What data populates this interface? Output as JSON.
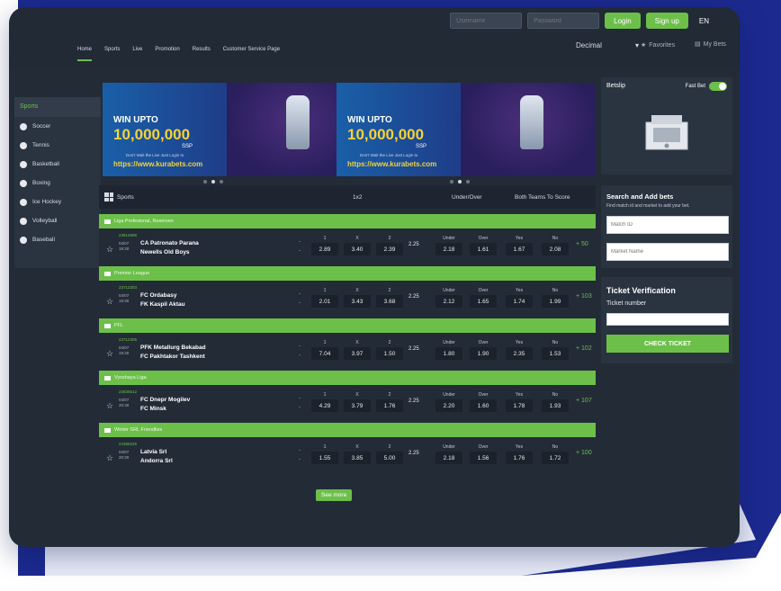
{
  "header": {
    "username_placeholder": "Username",
    "password_placeholder": "Password",
    "login_label": "Login",
    "signup_label": "Sign up",
    "language": "EN",
    "odds_format": "Decimal",
    "favorites_label": "Favorites",
    "mybets_label": "My Bets"
  },
  "nav": [
    "Home",
    "Sports",
    "Live",
    "Promotion",
    "Results",
    "Customer Service Page"
  ],
  "sidebar": {
    "title": "Sports",
    "items": [
      "Soccer",
      "Tennis",
      "Basketball",
      "Boxing",
      "Ice Hockey",
      "Volleyball",
      "Baseball"
    ]
  },
  "banner": {
    "win": "WIN UPTO",
    "amount": "10,000,000",
    "currency": "SSP",
    "small": "Don't Wait the Live Just Login to",
    "url": "https://www.kurabets.com"
  },
  "table": {
    "col_sports": "Sports",
    "col_1x2": "1x2",
    "col_uo": "Under/Over",
    "col_bts": "Both Teams To Score",
    "labels": [
      "1",
      "X",
      "2",
      "Under",
      "Over",
      "Yes",
      "No"
    ]
  },
  "leagues": [
    {
      "name": "Liga Profesional, Reserves",
      "match": {
        "id": "23814998",
        "date": "04/07",
        "time": "19:30",
        "home": "CA Patronato Parana",
        "away": "Newells Old Boys",
        "o1": "2.89",
        "ox": "3.40",
        "o2": "2.39",
        "hcp": "2.25",
        "under": "2.18",
        "over": "1.61",
        "yes": "1.67",
        "no": "2.08",
        "more": "+ 50"
      }
    },
    {
      "name": "Premier League",
      "match": {
        "id": "23712303",
        "date": "04/07",
        "time": "19:30",
        "home": "FC Ordabasy",
        "away": "FK Kaspil Aktau",
        "o1": "2.01",
        "ox": "3.43",
        "o2": "3.68",
        "hcp": "2.25",
        "under": "2.12",
        "over": "1.65",
        "yes": "1.74",
        "no": "1.99",
        "more": "+ 103"
      }
    },
    {
      "name": "PFL",
      "match": {
        "id": "23712305",
        "date": "04/07",
        "time": "19:30",
        "home": "PFK Metallurg Bekabad",
        "away": "FC Pakhtakor Tashkent",
        "o1": "7.04",
        "ox": "3.97",
        "o2": "1.50",
        "hcp": "2.25",
        "under": "1.80",
        "over": "1.90",
        "yes": "2.35",
        "no": "1.53",
        "more": "+ 102"
      }
    },
    {
      "name": "Vysshaya Liga",
      "match": {
        "id": "23835512",
        "date": "04/07",
        "time": "20:30",
        "home": "FC Dnepr Mogilev",
        "away": "FC Minsk",
        "o1": "4.29",
        "ox": "3.79",
        "o2": "1.76",
        "hcp": "2.25",
        "under": "2.20",
        "over": "1.60",
        "yes": "1.78",
        "no": "1.93",
        "more": "+ 107"
      }
    },
    {
      "name": "Winter SRL Friendlies",
      "match": {
        "id": "24366225",
        "date": "04/07",
        "time": "20:30",
        "home": "Latvia Srl",
        "away": "Andorra Srl",
        "o1": "1.55",
        "ox": "3.85",
        "o2": "5.00",
        "hcp": "2.25",
        "under": "2.18",
        "over": "1.56",
        "yes": "1.76",
        "no": "1.72",
        "more": "+ 100"
      }
    }
  ],
  "see_more": "See more",
  "right": {
    "betslip": "Betslip",
    "fast_bet": "Fast Bet",
    "search_title": "Search and Add bets",
    "search_sub": "Find match id and market to add your bet.",
    "match_id_placeholder": "Match ID",
    "market_placeholder": "Market Name",
    "ticket_title": "Ticket Verification",
    "ticket_number": "Ticket number",
    "check_ticket": "CHECK TICKET"
  },
  "colors": {
    "accent": "#6cc04a",
    "panel": "#232b37",
    "frame_blue": "#1f2a8c"
  }
}
